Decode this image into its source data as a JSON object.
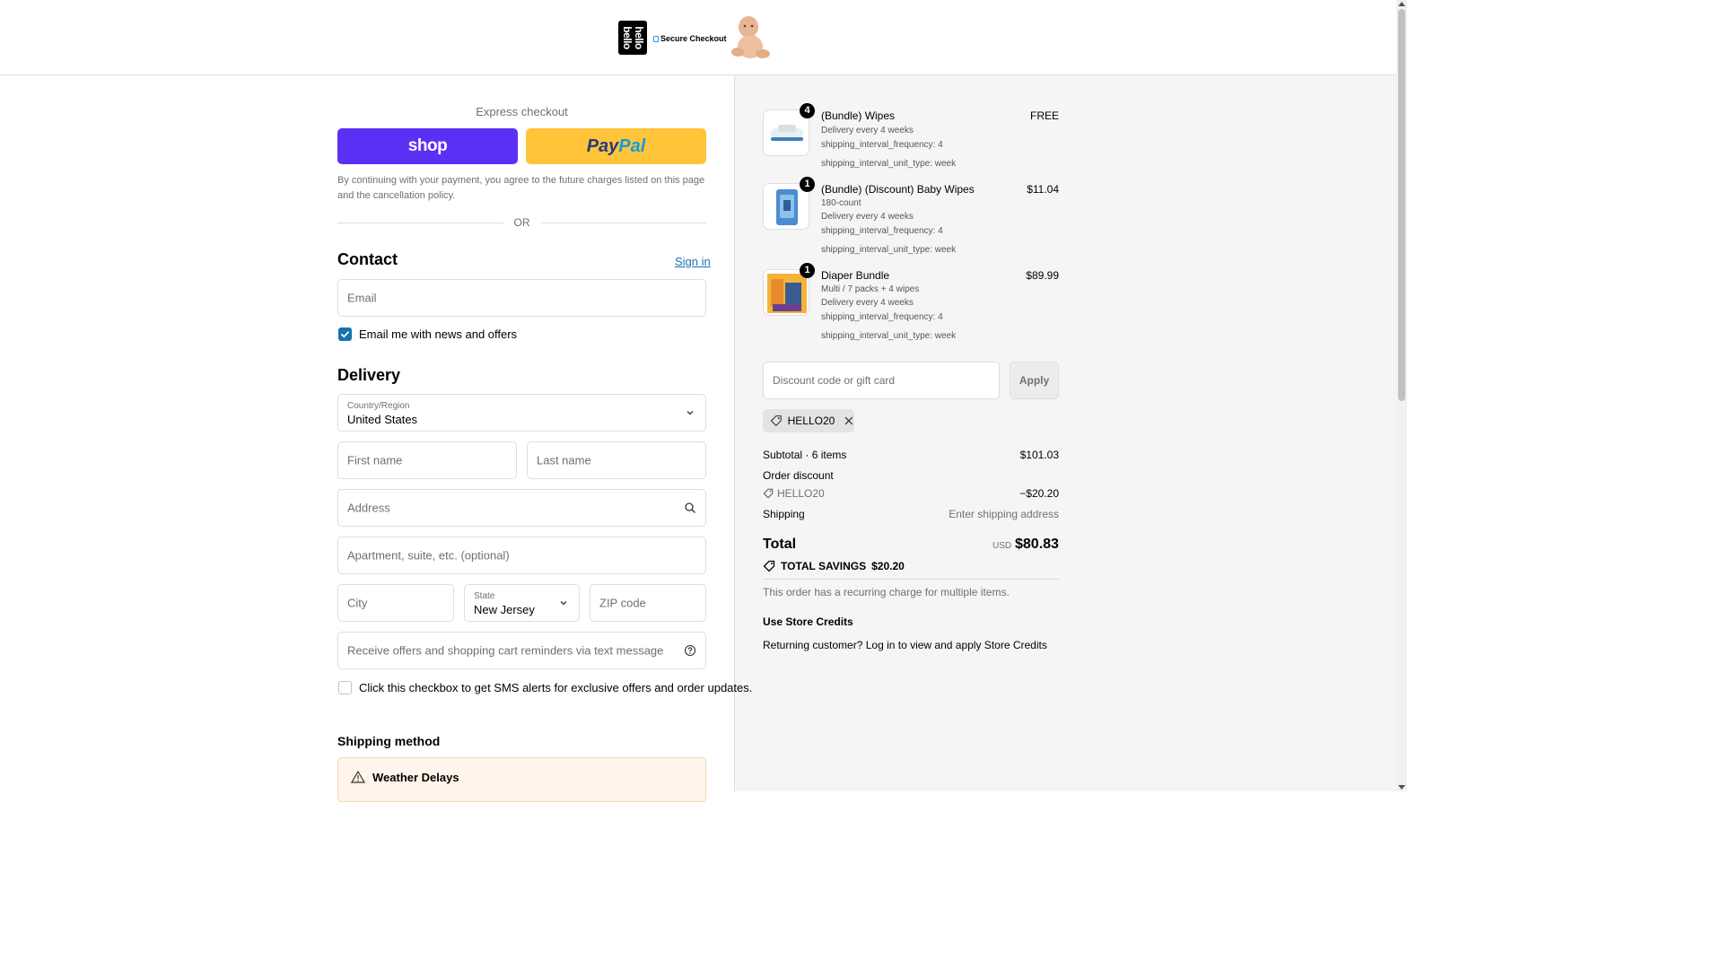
{
  "header": {
    "logo_text": "hello bello",
    "secure_text": "Secure Checkout"
  },
  "express": {
    "title": "Express checkout",
    "shop_label": "shop",
    "paypal_part1": "Pay",
    "paypal_part2": "Pal",
    "legal": "By continuing with your payment, you agree to the future charges listed on this page and the cancellation policy.",
    "or": "OR"
  },
  "contact": {
    "heading": "Contact",
    "signin": "Sign in",
    "email_placeholder": "Email",
    "newsletter_label": "Email me with news and offers",
    "newsletter_checked": true
  },
  "delivery": {
    "heading": "Delivery",
    "country_label": "Country/Region",
    "country_value": "United States",
    "first_name_placeholder": "First name",
    "last_name_placeholder": "Last name",
    "address_placeholder": "Address",
    "apartment_placeholder": "Apartment, suite, etc. (optional)",
    "city_placeholder": "City",
    "state_label": "State",
    "state_value": "New Jersey",
    "zip_placeholder": "ZIP code",
    "sms_placeholder": "Receive offers and shopping cart reminders via text message",
    "sms_label": "Click this checkbox to get SMS alerts for exclusive offers and order updates."
  },
  "shipping": {
    "heading": "Shipping method",
    "notice_title": "Weather Delays"
  },
  "cart": {
    "items": [
      {
        "qty": "4",
        "name": "(Bundle) Wipes",
        "price": "FREE",
        "meta": [
          "Delivery every 4 weeks",
          "shipping_interval_frequency: 4",
          "shipping_interval_unit_type: week"
        ]
      },
      {
        "qty": "1",
        "name": "(Bundle) (Discount) Baby Wipes",
        "price": "$11.04",
        "meta": [
          "180-count",
          "Delivery every 4 weeks",
          "shipping_interval_frequency: 4",
          "shipping_interval_unit_type: week"
        ]
      },
      {
        "qty": "1",
        "name": "Diaper Bundle",
        "price": "$89.99",
        "meta": [
          "Multi / 7 packs + 4 wipes",
          "Delivery every 4 weeks",
          "shipping_interval_frequency: 4",
          "shipping_interval_unit_type: week"
        ]
      }
    ],
    "discount_placeholder": "Discount code or gift card",
    "apply_label": "Apply",
    "applied_code": "HELLO20"
  },
  "summary": {
    "subtotal_label": "Subtotal · 6 items",
    "subtotal_value": "$101.03",
    "order_discount_label": "Order discount",
    "discount_code": "HELLO20",
    "discount_value": "−$20.20",
    "shipping_label": "Shipping",
    "shipping_value": "Enter shipping address",
    "total_label": "Total",
    "currency": "USD",
    "total_value": "$80.83",
    "savings_label": "TOTAL SAVINGS",
    "savings_value": "$20.20",
    "recurring_note": "This order has a recurring charge for multiple items.",
    "credits_heading": "Use Store Credits",
    "credits_text": "Returning customer? Log in to view and apply Store Credits"
  },
  "colors": {
    "shop": "#5a31f4",
    "paypal": "#ffc439",
    "link": "#1773b0",
    "sidebar_bg": "#f5f5f5"
  }
}
